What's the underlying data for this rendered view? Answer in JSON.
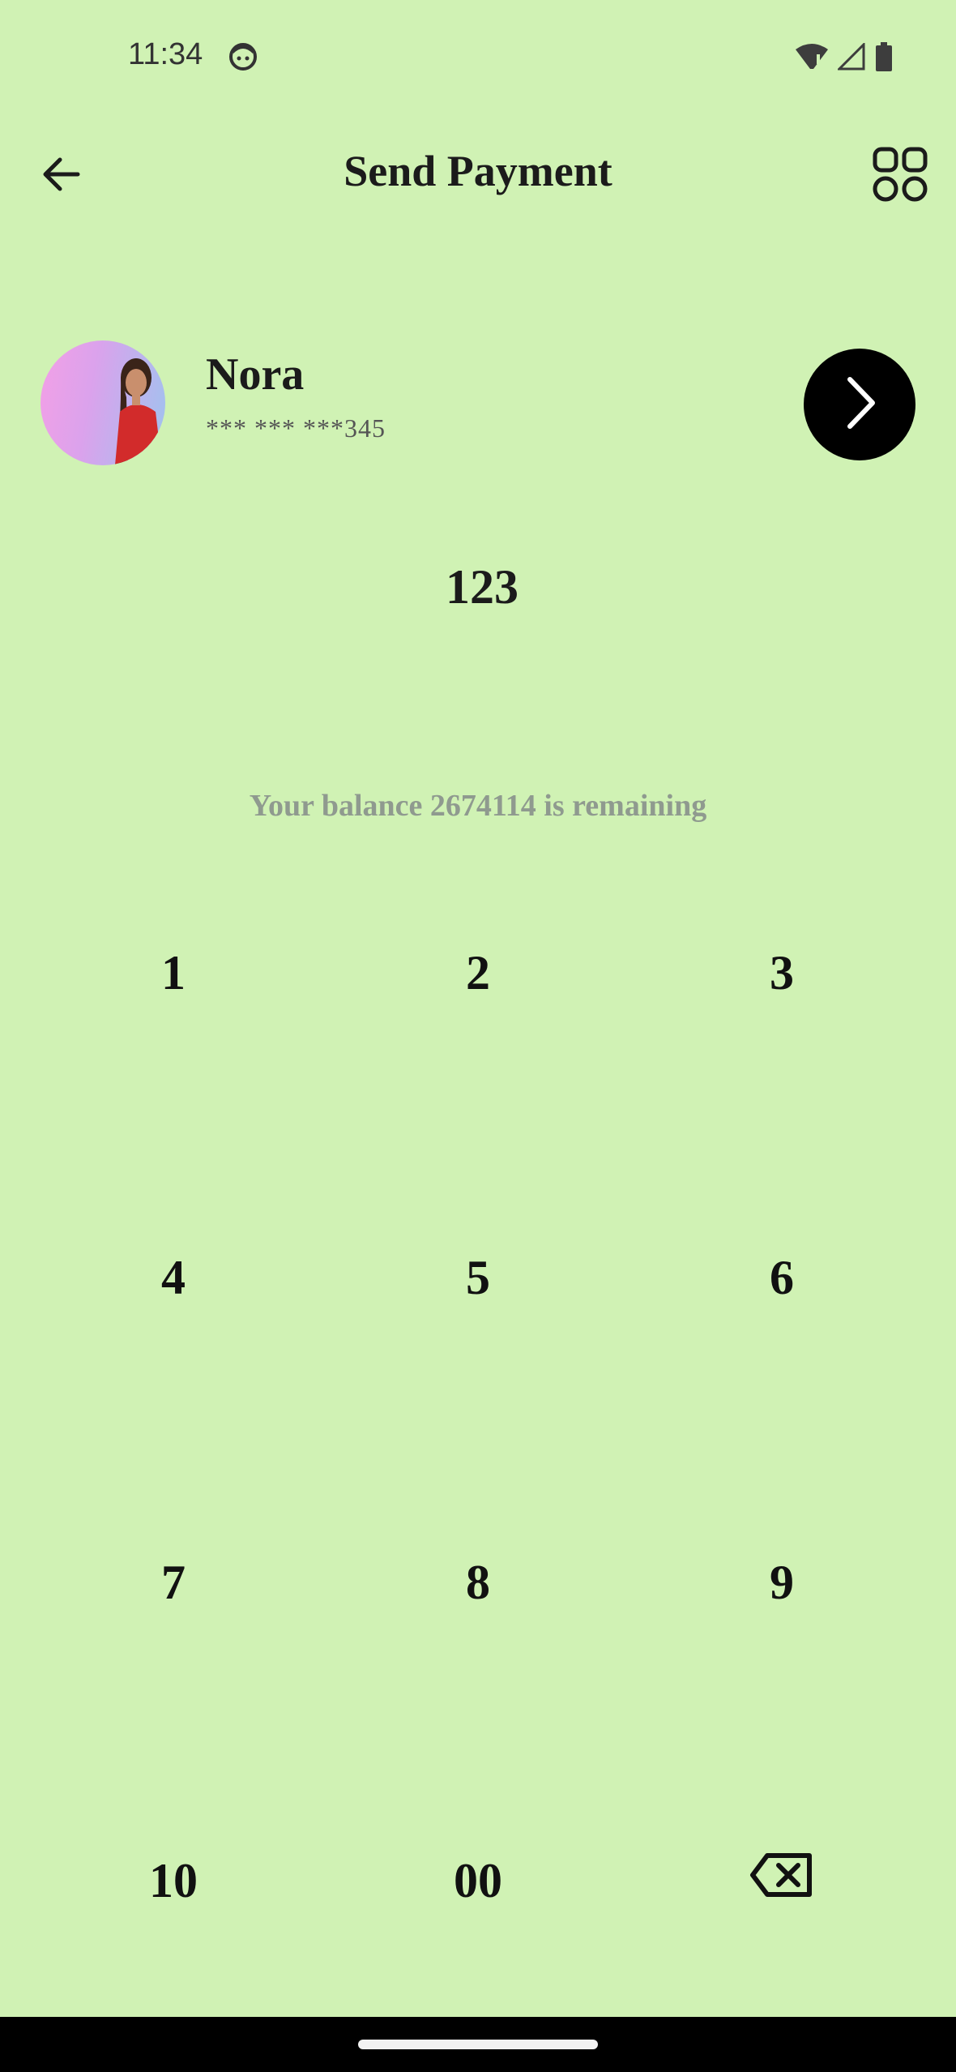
{
  "status_bar": {
    "time": "11:34",
    "icons": [
      "face-icon",
      "wifi-icon",
      "signal-icon",
      "battery-icon"
    ]
  },
  "header": {
    "title": "Send Payment",
    "back_icon": "arrow-left-icon",
    "menu_icon": "grid-icon"
  },
  "recipient": {
    "name": "Nora",
    "masked_account": "*** *** ***",
    "account_suffix": "345"
  },
  "amount": {
    "value": "123"
  },
  "balance_text": "Your balance 2674114 is remaining",
  "keypad": {
    "keys": [
      "1",
      "2",
      "3",
      "4",
      "5",
      "6",
      "7",
      "8",
      "9",
      "10",
      "00"
    ],
    "backspace_icon": "backspace-icon"
  },
  "colors": {
    "background": "#d0f2b4",
    "accent_button": "#000000",
    "muted_text": "#8f9a8f"
  }
}
